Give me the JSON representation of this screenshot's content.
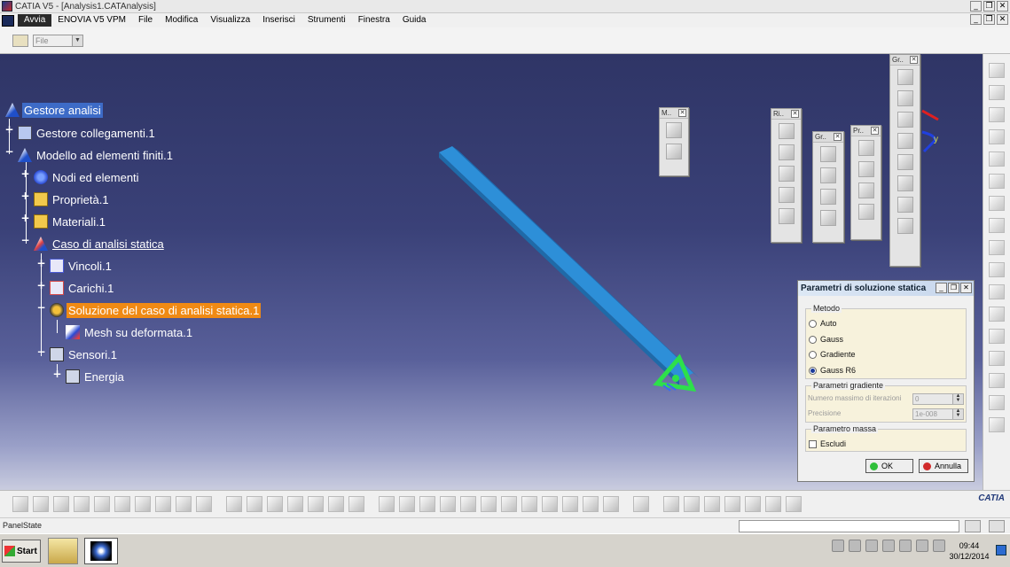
{
  "window": {
    "title": "CATIA V5 - [Analysis1.CATAnalysis]",
    "min": "_",
    "restore": "❐",
    "close": "✕"
  },
  "menubar": {
    "items": [
      "Avvia",
      "ENOVIA V5 VPM",
      "File",
      "Modifica",
      "Visualizza",
      "Inserisci",
      "Strumenti",
      "Finestra",
      "Guida"
    ]
  },
  "toolbar": {
    "file_combo": "File"
  },
  "tree": {
    "nodes": [
      {
        "label": "Gestore analisi",
        "icon": "analysis-manager-icon",
        "state": "selected"
      },
      {
        "label": "Gestore collegamenti.1",
        "icon": "links-manager-icon"
      },
      {
        "label": "Modello ad elementi finiti.1",
        "icon": "finite-element-model-icon"
      },
      {
        "label": "Nodi ed elementi",
        "icon": "nodes-elements-icon"
      },
      {
        "label": "Proprietà.1",
        "icon": "folder-icon"
      },
      {
        "label": "Materiali.1",
        "icon": "folder-icon"
      },
      {
        "label": "Caso di analisi statica",
        "icon": "static-case-icon",
        "state": "underlined"
      },
      {
        "label": "Vincoli.1",
        "icon": "restraints-icon"
      },
      {
        "label": "Carichi.1",
        "icon": "loads-icon"
      },
      {
        "label": "Soluzione del caso di analisi statica.1",
        "icon": "solution-icon",
        "state": "highlighted"
      },
      {
        "label": "Mesh su deformata.1",
        "icon": "deformed-mesh-icon"
      },
      {
        "label": "Sensori.1",
        "icon": "sensors-icon"
      },
      {
        "label": "Energia",
        "icon": "energy-icon"
      }
    ]
  },
  "palettes": {
    "p1": "M..",
    "p2": "Ri..",
    "p3": "Gr..",
    "p4": "Pr..",
    "p5": "Gr.."
  },
  "axis_label_y": "y",
  "dialog": {
    "title": "Parametri di soluzione statica",
    "metodo": {
      "title": "Metodo",
      "options": [
        "Auto",
        "Gauss",
        "Gradiente",
        "Gauss R6"
      ],
      "selected": "Gauss R6"
    },
    "gradiente": {
      "title": "Parametri gradiente",
      "iter_label": "Numero massimo di iterazioni",
      "iter_value": "0",
      "prec_label": "Precisione",
      "prec_value": "1e-008"
    },
    "massa": {
      "title": "Parametro massa",
      "escludi": "Escludi"
    },
    "ok": "OK",
    "annulla": "Annulla"
  },
  "statusbar": {
    "text": "PanelState"
  },
  "taskbar": {
    "start": "Start",
    "time": "09:44",
    "date": "30/12/2014"
  },
  "brand": "CATIA",
  "colors": {
    "selection": "#3d6bc7",
    "highlight": "#f08a14",
    "beam": "#2a8bd4",
    "clamp": "#2de04a"
  }
}
